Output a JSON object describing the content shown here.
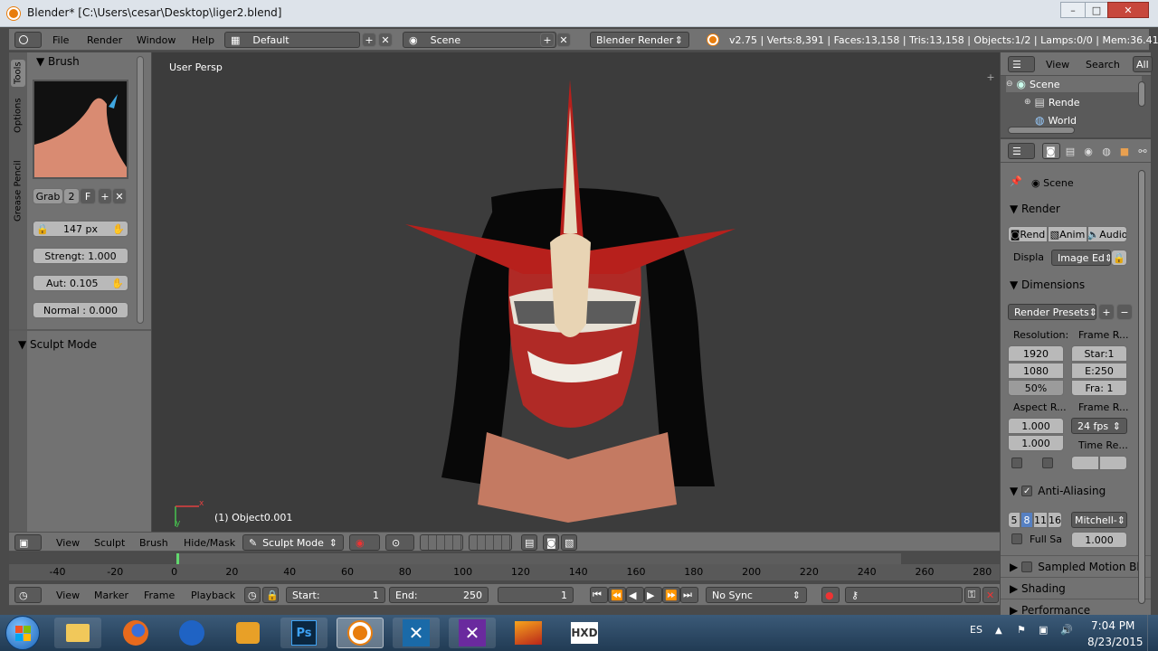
{
  "window": {
    "title": "Blender* [C:\\Users\\cesar\\Desktop\\liger2.blend]",
    "minimize": "–",
    "maximize": "□",
    "close": "✕"
  },
  "info_header": {
    "menus": [
      "File",
      "Render",
      "Window",
      "Help"
    ],
    "layout": "Default",
    "scene": "Scene",
    "engine": "Blender Render",
    "stats": "v2.75 | Verts:8,391 | Faces:13,158 | Tris:13,158 | Objects:1/2 | Lamps:0/0 | Mem:36.41M |"
  },
  "tool_shelf": {
    "tabs": [
      "Tools",
      "Options",
      "Grease Pencil"
    ],
    "brush_panel": "Brush",
    "brush_name": "Grab",
    "brush_users": "2",
    "fake_user": "F",
    "radius": "147 px",
    "strength": "Strengt:  1.000",
    "autosmooth": "Aut:  0.105",
    "normal": "Normal :  0.000",
    "sculpt_mode_panel": "Sculpt Mode"
  },
  "viewport": {
    "view_name": "User Persp",
    "object_label": "(1) Object0.001",
    "axis_x": "x",
    "axis_y": "y"
  },
  "view3d_header": {
    "menus": [
      "View",
      "Sculpt",
      "Brush",
      "Hide/Mask"
    ],
    "mode": "Sculpt Mode"
  },
  "timeline": {
    "ticks": [
      "-40",
      "-20",
      "0",
      "20",
      "40",
      "60",
      "80",
      "100",
      "120",
      "140",
      "160",
      "180",
      "200",
      "220",
      "240",
      "260",
      "280"
    ],
    "menus": [
      "View",
      "Marker",
      "Frame",
      "Playback"
    ],
    "start": "Start:",
    "start_val": "1",
    "end": "End:",
    "end_val": "250",
    "current": "1",
    "sync": "No Sync"
  },
  "outliner": {
    "menus": [
      "View",
      "Search"
    ],
    "filter": "All",
    "items": [
      "Scene",
      "Rende",
      "World"
    ]
  },
  "properties": {
    "scene_label": "Scene",
    "render_panel": "Render",
    "render_buttons": [
      "Rend",
      "Anim",
      "Audio"
    ],
    "display_label": "Displa",
    "display_value": "Image Ed",
    "dimensions_panel": "Dimensions",
    "render_presets": "Render Presets",
    "resolution_label": "Resolution:",
    "frame_range_label": "Frame R...",
    "res_x": "1920",
    "res_y": "1080",
    "res_pct": "50%",
    "frame_start": "Star:1",
    "frame_end": "E:250",
    "frame_step": "Fra: 1",
    "aspect_label": "Aspect R...",
    "frame_rate_label": "Frame R...",
    "aspect_x": "1.000",
    "aspect_y": "1.000",
    "fps": "24 fps",
    "time_remap_label": "Time Re...",
    "aa_panel": "Anti-Aliasing",
    "aa_samples": [
      "5",
      "8",
      "11",
      "16"
    ],
    "aa_filter": "Mitchell-",
    "full_sample": "Full Sa",
    "filter_size": "1.000",
    "motion_blur_panel": "Sampled Motion Bl",
    "shading_panel": "Shading",
    "performance_panel": "Performance"
  },
  "taskbar": {
    "apps": [
      "Explorer",
      "Firefox",
      "Media Center",
      "Media Player",
      "Ps",
      "Blender",
      "X-Tool",
      "Xplore",
      "Video",
      "HXD"
    ],
    "lang": "ES",
    "time": "7:04 PM",
    "date": "8/23/2015"
  }
}
